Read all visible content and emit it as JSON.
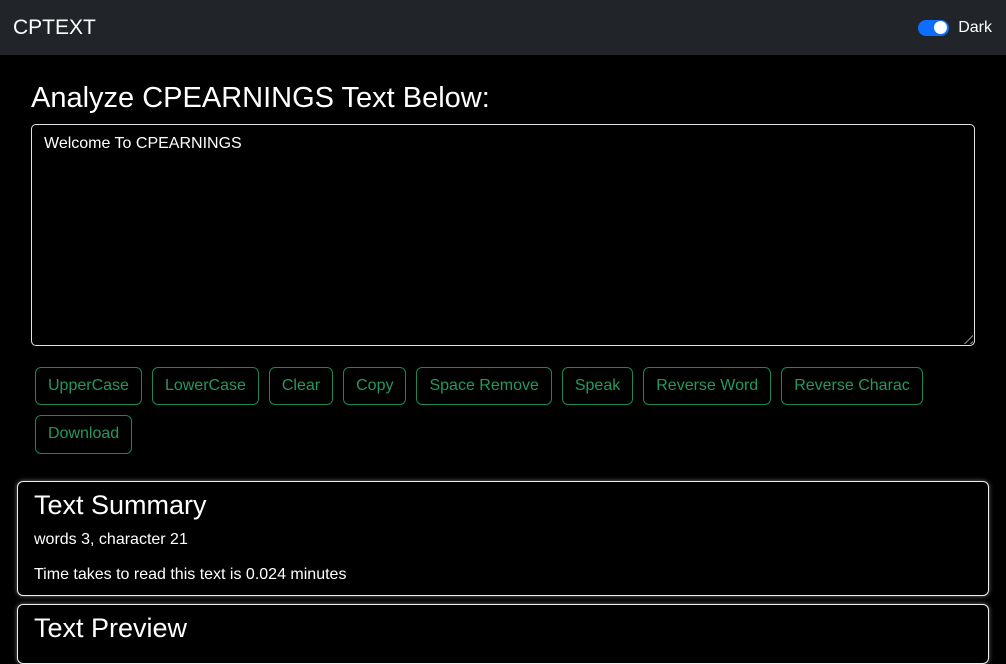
{
  "colors": {
    "page_bg": "#000000",
    "navbar_bg": "#212529",
    "button_green": "#198754",
    "toggle_blue": "#0d6efd"
  },
  "navbar": {
    "brand": "CPTEXT",
    "theme_toggle": {
      "label": "Dark",
      "state": "on"
    }
  },
  "main": {
    "heading": "Analyze CPEARNINGS Text Below:",
    "textarea": {
      "value": "Welcome To CPEARNINGS"
    },
    "buttons": [
      "UpperCase",
      "LowerCase",
      "Clear",
      "Copy",
      "Space Remove",
      "Speak",
      "Reverse Word",
      "Reverse Charac",
      "Download"
    ]
  },
  "summary": {
    "title": "Text Summary",
    "word_char_line": "words 3, character 21",
    "read_time_line": "Time takes to read this text is 0.024 minutes"
  },
  "preview": {
    "title": "Text Preview"
  }
}
